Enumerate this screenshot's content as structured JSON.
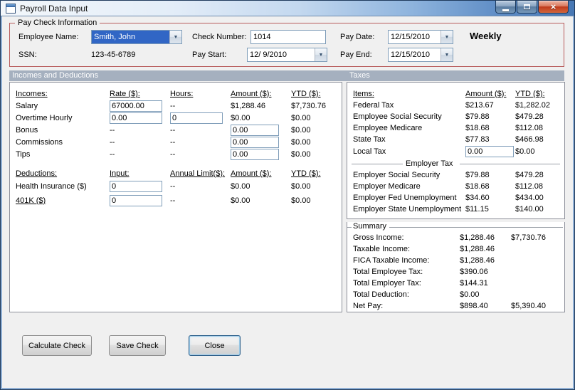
{
  "window": {
    "title": "Payroll Data Input"
  },
  "icons": {
    "app_icon": "form-window",
    "minimize": "minimize-dash",
    "maximize": "maximize-square",
    "close": "×",
    "dropdown": "▼"
  },
  "colors": {
    "paycheck_group_border": "#b85b5b",
    "section_header_bg": "#a5b0bf",
    "selection_blue": "#3166c5",
    "titlebar_blue": "#4878b4",
    "close_button_red": "#bf3a1c"
  },
  "paycheck": {
    "title": "Pay Check Information",
    "employee_name": {
      "label": "Employee Name:",
      "value": "Smith, John"
    },
    "ssn": {
      "label": "SSN:",
      "value": "123-45-6789"
    },
    "check_number": {
      "label": "Check Number:",
      "value": "1014"
    },
    "pay_start": {
      "label": "Pay Start:",
      "value": "12/ 9/2010"
    },
    "pay_date": {
      "label": "Pay Date:",
      "value": "12/15/2010"
    },
    "pay_end": {
      "label": "Pay End:",
      "value": "12/15/2010"
    },
    "frequency": "Weekly"
  },
  "sections": {
    "incomes_deductions": "Incomes and Deductions",
    "taxes": "Taxes"
  },
  "incomes": {
    "headers": {
      "name": "Incomes:",
      "rate": "Rate ($):",
      "hours": "Hours:",
      "amount": "Amount ($):",
      "ytd": "YTD ($):"
    },
    "salary": {
      "label": "Salary",
      "rate": "67000.00",
      "hours": "--",
      "amount": "$1,288.46",
      "ytd": "$7,730.76"
    },
    "overtime": {
      "label": "Overtime Hourly",
      "rate": "0.00",
      "hours": "0",
      "amount": "$0.00",
      "ytd": "$0.00"
    },
    "bonus": {
      "label": "Bonus",
      "rate": "--",
      "hours": "--",
      "amount": "0.00",
      "ytd": "$0.00"
    },
    "commissions": {
      "label": "Commissions",
      "rate": "--",
      "hours": "--",
      "amount": "0.00",
      "ytd": "$0.00"
    },
    "tips": {
      "label": "Tips",
      "rate": "--",
      "hours": "--",
      "amount": "0.00",
      "ytd": "$0.00"
    }
  },
  "deductions": {
    "headers": {
      "name": "Deductions:",
      "input": "Input:",
      "limit": "Annual Limit($):",
      "amount": "Amount ($):",
      "ytd": "YTD ($):"
    },
    "health": {
      "label": "Health Insurance ($)",
      "input": "0",
      "limit": "--",
      "amount": "$0.00",
      "ytd": "$0.00"
    },
    "k401": {
      "label": "401K ($)",
      "input": "0",
      "limit": "--",
      "amount": "$0.00",
      "ytd": "$0.00"
    }
  },
  "taxes": {
    "headers": {
      "items": "Items:",
      "amount": "Amount ($):",
      "ytd": "YTD ($):"
    },
    "employee_rows": [
      {
        "label": "Federal Tax",
        "amount": "$213.67",
        "ytd": "$1,282.02"
      },
      {
        "label": "Employee Social Security",
        "amount": "$79.88",
        "ytd": "$479.28"
      },
      {
        "label": "Employee Medicare",
        "amount": "$18.68",
        "ytd": "$112.08"
      },
      {
        "label": "State Tax",
        "amount": "$77.83",
        "ytd": "$466.98"
      }
    ],
    "local_tax": {
      "label": "Local Tax",
      "amount": "0.00",
      "ytd": "$0.00"
    },
    "employer_divider": "Employer Tax",
    "employer_rows": [
      {
        "label": "Employer Social Security",
        "amount": "$79.88",
        "ytd": "$479.28"
      },
      {
        "label": "Employer Medicare",
        "amount": "$18.68",
        "ytd": "$112.08"
      },
      {
        "label": "Employer Fed Unemployment",
        "amount": "$34.60",
        "ytd": "$434.00"
      },
      {
        "label": "Employer State Unemployment",
        "amount": "$11.15",
        "ytd": "$140.00"
      }
    ]
  },
  "summary": {
    "title": "Summary",
    "rows": [
      {
        "label": "Gross Income:",
        "amount": "$1,288.46",
        "ytd": "$7,730.76"
      },
      {
        "label": "Taxable Income:",
        "amount": "$1,288.46",
        "ytd": ""
      },
      {
        "label": "FICA Taxable Income:",
        "amount": "$1,288.46",
        "ytd": ""
      },
      {
        "label": "Total Employee Tax:",
        "amount": "$390.06",
        "ytd": ""
      },
      {
        "label": "Total Employer Tax:",
        "amount": "$144.31",
        "ytd": ""
      },
      {
        "label": "Total Deduction:",
        "amount": "$0.00",
        "ytd": ""
      },
      {
        "label": "Net Pay:",
        "amount": "$898.40",
        "ytd": "$5,390.40"
      }
    ]
  },
  "buttons": {
    "calculate": "Calculate Check",
    "save": "Save Check",
    "close": "Close"
  }
}
